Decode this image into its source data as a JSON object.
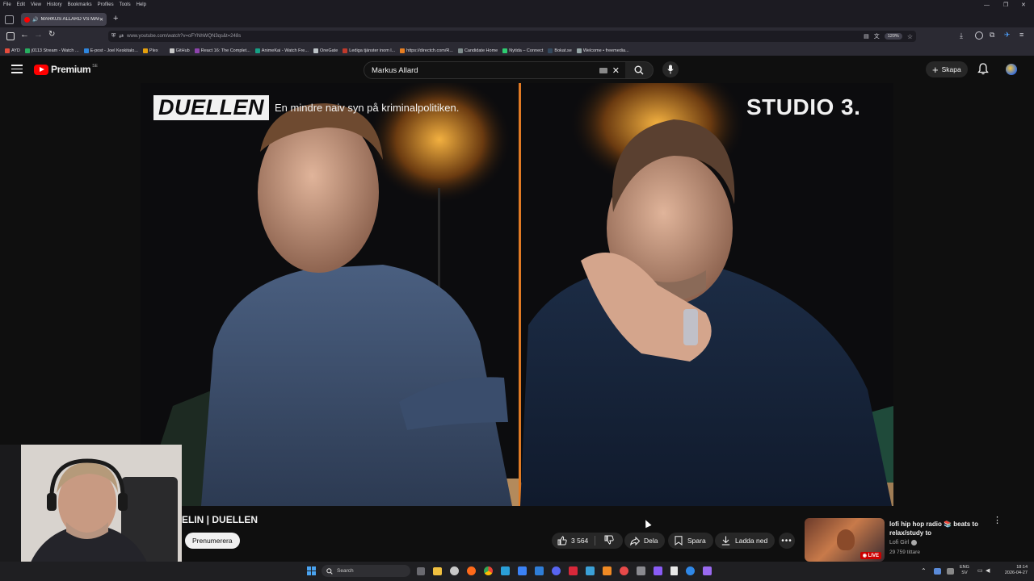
{
  "browser": {
    "menu": [
      "File",
      "Edit",
      "View",
      "History",
      "Bookmarks",
      "Profiles",
      "Tools",
      "Help"
    ],
    "tab_title": "MARKUS ALLARD VS MARI",
    "url": "www.youtube.com/watch?v=oFYNhWQN3qs&t=248s",
    "zoom": "120%",
    "bookmarks": [
      {
        "label": "AYD",
        "color": "#e74c3c"
      },
      {
        "label": "j0113 Stream - Watch ...",
        "color": "#27ae60"
      },
      {
        "label": "E-post - Joel Keskitalo...",
        "color": "#2e86de"
      },
      {
        "label": "Plex",
        "color": "#e5a00d"
      },
      {
        "label": "GitHub",
        "color": "#c8c8c8"
      },
      {
        "label": "React 16: The Complet...",
        "color": "#8e44ad"
      },
      {
        "label": "AnimeKai - Watch Fre...",
        "color": "#16a085"
      },
      {
        "label": "OneGate",
        "color": "#bdc3c7"
      },
      {
        "label": "Lediga tjänster inom l...",
        "color": "#c0392b"
      },
      {
        "label": "https://directch.com/R...",
        "color": "#e67e22"
      },
      {
        "label": "Candidate Home",
        "color": "#7f8c8d"
      },
      {
        "label": "Nytida – Connect",
        "color": "#2ecc71"
      },
      {
        "label": "Bokat.se",
        "color": "#34495e"
      },
      {
        "label": "Welcome • freemedia...",
        "color": "#95a5a6"
      }
    ]
  },
  "youtube": {
    "logo_text": "Premium",
    "region": "SE",
    "search_value": "Markus Allard",
    "create_label": "Skapa"
  },
  "video": {
    "banner_title": "DUELLEN",
    "banner_tagline": "En mindre naiv syn på kriminalpolitiken.",
    "studio_label": "STUDIO 3."
  },
  "below": {
    "title_fragment": "ELIN | DUELLEN",
    "subscribe_label": "Prenumerera",
    "like_count": "3 564",
    "share_label": "Dela",
    "save_label": "Spara",
    "download_label": "Ladda ned"
  },
  "recommended": {
    "title": "lofi hip hop radio 📚 beats to relax/study to",
    "channel": "Lofi Girl",
    "viewers": "29 759 tittare",
    "live_label": "LIVE"
  },
  "taskbar": {
    "search_placeholder": "Search",
    "lang_top": "ENG",
    "lang_bottom": "SV",
    "time": "18:14",
    "date": "2026-04-27"
  }
}
